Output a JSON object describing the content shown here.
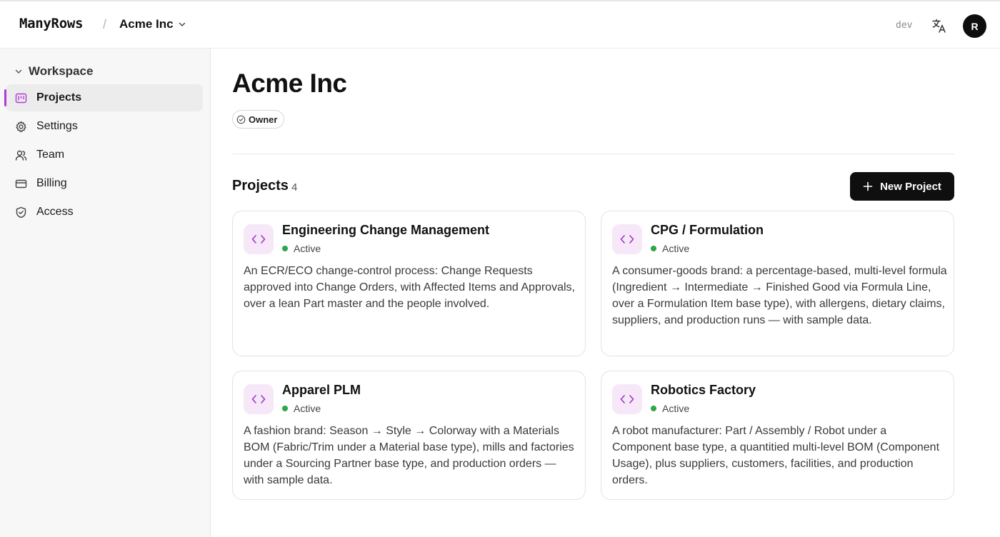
{
  "topbar": {
    "logo": "ManyRows",
    "separator": "/",
    "org_name": "Acme Inc",
    "env": "dev",
    "avatar_initial": "R"
  },
  "sidebar": {
    "section_label": "Workspace",
    "items": [
      {
        "label": "Projects",
        "icon": "kanban-icon",
        "active": true
      },
      {
        "label": "Settings",
        "icon": "gear-icon",
        "active": false
      },
      {
        "label": "Team",
        "icon": "users-icon",
        "active": false
      },
      {
        "label": "Billing",
        "icon": "credit-card-icon",
        "active": false
      },
      {
        "label": "Access",
        "icon": "shield-check-icon",
        "active": false
      }
    ]
  },
  "main": {
    "title": "Acme Inc",
    "role": "Owner",
    "projects_heading": "Projects",
    "projects_count": "4",
    "new_project_label": "New Project"
  },
  "projects": [
    {
      "name": "Engineering Change Management",
      "status": "Active",
      "description": "An ECR/ECO change-control process: Change Requests approved into Change Orders, with Affected Items and Approvals, over a lean Part master and the people involved."
    },
    {
      "name": "CPG / Formulation",
      "status": "Active",
      "description": "A consumer-goods brand: a percentage-based, multi-level formula (Ingredient → Intermediate → Finished Good via Formula Line, over a Formulation Item base type), with allergens, dietary claims, suppliers, and production runs — with sample data."
    },
    {
      "name": "Apparel PLM",
      "status": "Active",
      "description": "A fashion brand: Season → Style → Colorway with a Materials BOM (Fabric/Trim under a Material base type), mills and factories under a Sourcing Partner base type, and production orders — with sample data."
    },
    {
      "name": "Robotics Factory",
      "status": "Active",
      "description": "A robot manufacturer: Part / Assembly / Robot under a Component base type, a quantitied multi-level BOM (Component Usage), plus suppliers, customers, facilities, and production orders."
    }
  ],
  "colors": {
    "accent": "#b13bd6",
    "icon_bg": "#f6e8f9",
    "status_active": "#2aa84a",
    "primary_button": "#0f0f0f"
  }
}
